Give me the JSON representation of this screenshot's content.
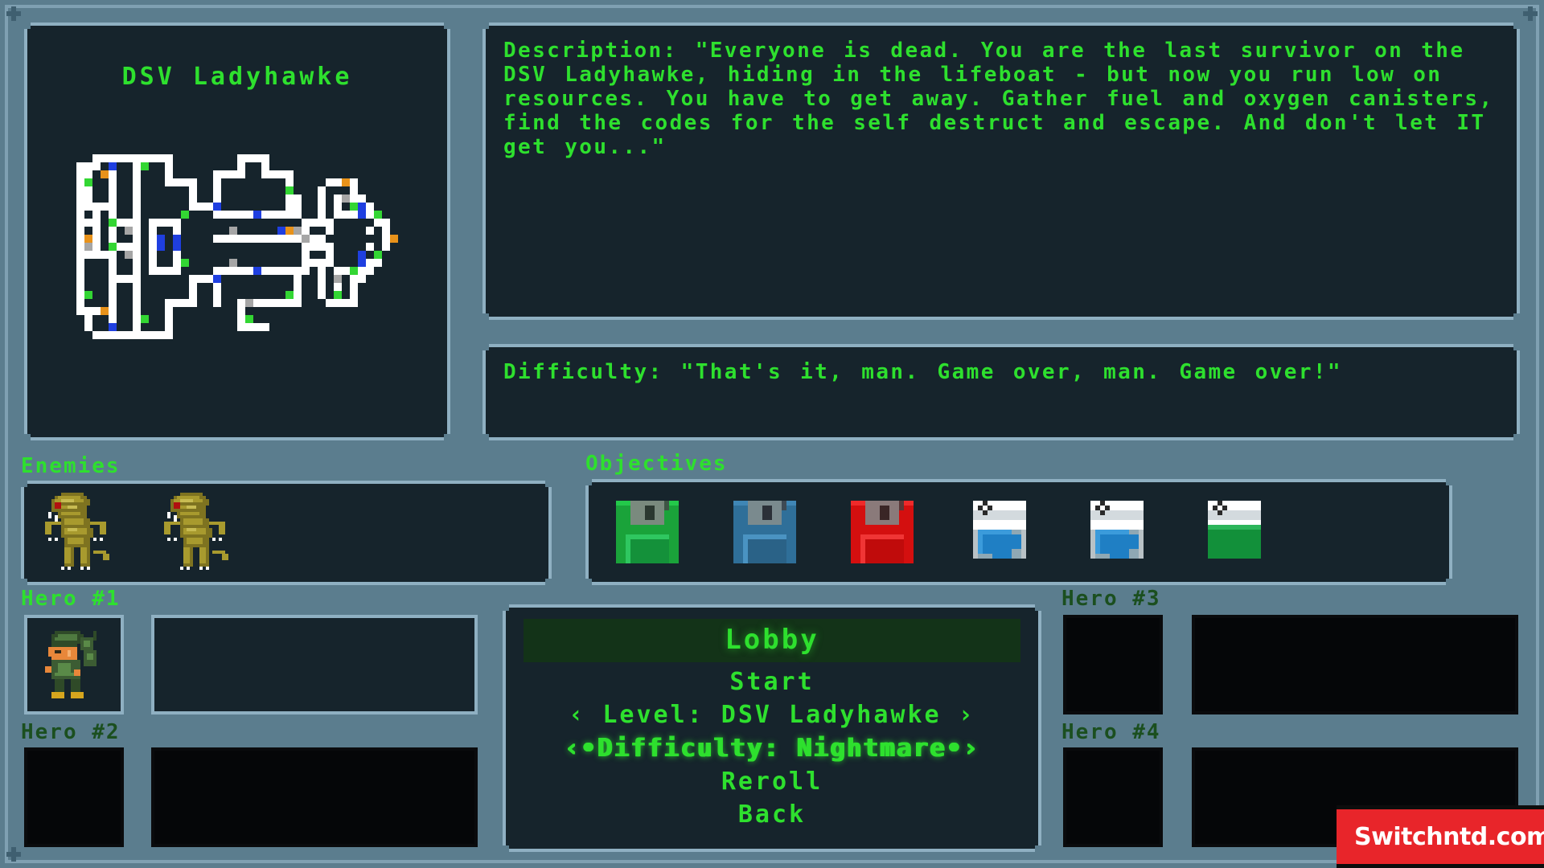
{
  "theme": {
    "bg": "#5b7d8e",
    "panel_bg": "#16242c",
    "panel_border": "#8fb0c2",
    "accent_green": "#2ee02e",
    "dim_green": "#1b4f1f",
    "menu_highlight_bg": "#133318"
  },
  "ship": {
    "title": "DSV Ladyhawke",
    "map_legend": {
      "wall": "#ffffff",
      "floor": "#0e1a20",
      "green_marker": "#33d633",
      "blue_marker": "#1f3fe0",
      "orange_marker": "#e8921a",
      "gray_marker": "#a6a6a6"
    }
  },
  "description": {
    "text": "Description: \"Everyone is dead. You are the last survivor on the DSV Ladyhawke, hiding in the lifeboat - but now you run low on resources. You have to get away. Gather fuel and oxygen canisters, find the codes for the self destruct and escape. And don't let IT get you...\""
  },
  "difficulty_quote": {
    "text": "Difficulty: \"That's it, man. Game over, man. Game over!\""
  },
  "enemies": {
    "label": "Enemies",
    "items": [
      {
        "name": "alien-drone",
        "color": "#a89a2e",
        "icon": "enemy-alien-icon"
      },
      {
        "name": "alien-drone",
        "color": "#a89a2e",
        "icon": "enemy-alien-icon"
      }
    ]
  },
  "objectives": {
    "label": "Objectives",
    "items": [
      {
        "name": "green-floppy-disk",
        "type": "floppy",
        "color": "#1aa33a",
        "icon": "floppy-disk-icon"
      },
      {
        "name": "blue-floppy-disk",
        "type": "floppy",
        "color": "#2f6f99",
        "icon": "floppy-disk-icon"
      },
      {
        "name": "red-floppy-disk",
        "type": "floppy",
        "color": "#d40f0f",
        "icon": "floppy-disk-icon"
      },
      {
        "name": "blue-canister-1",
        "type": "canister",
        "color": "#1f7fc4",
        "icon": "canister-icon"
      },
      {
        "name": "blue-canister-2",
        "type": "canister",
        "color": "#1f7fc4",
        "icon": "canister-icon"
      },
      {
        "name": "green-canister",
        "type": "canister",
        "color": "#12903a",
        "icon": "canister-icon"
      }
    ]
  },
  "menu": {
    "header": "Lobby",
    "items": [
      {
        "label": "Start",
        "selected": false
      },
      {
        "label": "‹ Level: DSV Ladyhawke ›",
        "selected": false
      },
      {
        "label": "‹•Difficulty: Nightmare•›",
        "selected": true
      },
      {
        "label": "Reroll",
        "selected": false
      },
      {
        "label": "Back",
        "selected": false
      }
    ]
  },
  "heroes": [
    {
      "label": "Hero #1",
      "occupied": true,
      "sprite": "soldier-green",
      "side": "left",
      "slot": 1
    },
    {
      "label": "Hero #2",
      "occupied": false,
      "sprite": null,
      "side": "left",
      "slot": 2
    },
    {
      "label": "Hero #3",
      "occupied": false,
      "sprite": null,
      "side": "right",
      "slot": 3
    },
    {
      "label": "Hero #4",
      "occupied": false,
      "sprite": null,
      "side": "right",
      "slot": 4
    }
  ],
  "watermark": {
    "text": "Switchntd.com",
    "bg": "#e8252a"
  }
}
